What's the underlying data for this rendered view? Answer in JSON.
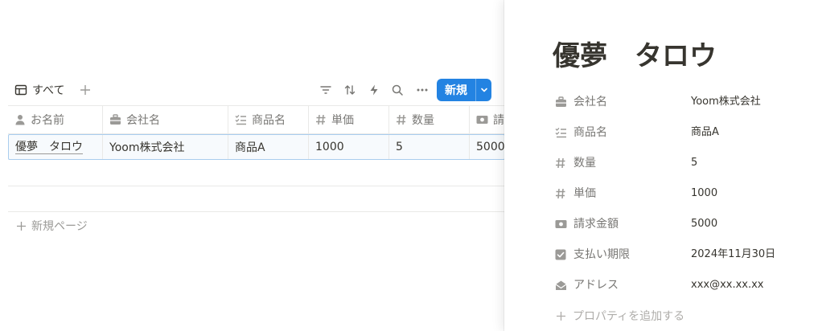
{
  "view": {
    "tab_label": "すべて",
    "new_button_label": "新規"
  },
  "table": {
    "headers": [
      "お名前",
      "会社名",
      "商品名",
      "単価",
      "数量",
      "請"
    ],
    "row": [
      "優夢　タロウ",
      "Yoom株式会社",
      "商品A",
      "1000",
      "5",
      "5000"
    ]
  },
  "new_page_label": "新規ページ",
  "panel": {
    "title": "優夢　タロウ",
    "properties": [
      {
        "name": "会社名",
        "value": "Yoom株式会社",
        "icon": "briefcase-icon"
      },
      {
        "name": "商品名",
        "value": "商品A",
        "icon": "checklist-icon"
      },
      {
        "name": "数量",
        "value": "5",
        "icon": "hash-icon"
      },
      {
        "name": "単価",
        "value": "1000",
        "icon": "hash-icon"
      },
      {
        "name": "請求金額",
        "value": "5000",
        "icon": "money-icon"
      },
      {
        "name": "支払い期限",
        "value": "2024年11月30日",
        "icon": "checkbox-icon"
      },
      {
        "name": "アドレス",
        "value": "xxx@xx.xx.xx",
        "icon": "envelope-icon"
      }
    ],
    "add_property_label": "プロパティを追加する"
  },
  "colors": {
    "accent": "#2383e2",
    "text": "#37352f",
    "muted": "#787774",
    "border": "#e9e9e7"
  }
}
